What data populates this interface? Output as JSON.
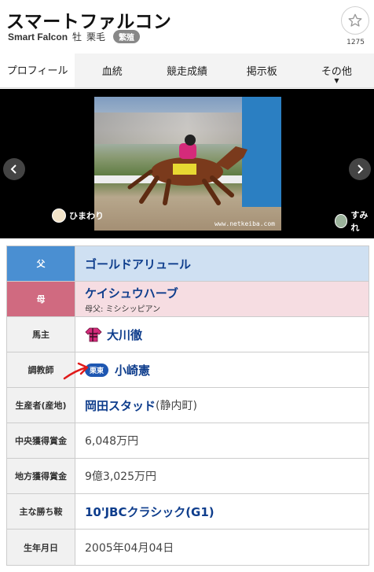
{
  "header": {
    "title": "スマートファルコン",
    "name_en": "Smart Falcon",
    "sex": "牡",
    "coat": "栗毛",
    "status_badge": "繁殖",
    "favorite_count": "1275"
  },
  "tabs": [
    {
      "label": "プロフィール",
      "active": true
    },
    {
      "label": "血統",
      "active": false
    },
    {
      "label": "競走成績",
      "active": false
    },
    {
      "label": "掲示板",
      "active": false
    },
    {
      "label": "その他",
      "active": false
    }
  ],
  "photo": {
    "watermark": "www.netkeiba.com",
    "credit_left": "ひまわり",
    "credit_right": "すみれ"
  },
  "profile": {
    "sire_label": "父",
    "sire": "ゴールドアリュール",
    "dam_label": "母",
    "dam": "ケイシュウハーブ",
    "dam_sire": "母父: ミシシッピアン",
    "owner_label": "馬主",
    "owner": "大川徹",
    "trainer_label": "調教師",
    "trainer_affil": "栗東",
    "trainer": "小崎憲",
    "breeder_label": "生産者(産地)",
    "breeder": "岡田スタッド",
    "breeder_region": "(静内町)",
    "central_earnings_label": "中央獲得賞金",
    "central_earnings": "6,048万円",
    "local_earnings_label": "地方獲得賞金",
    "local_earnings": "9億3,025万円",
    "major_win_label": "主な勝ち鞍",
    "major_win": "10'JBCクラシック(G1)",
    "birthdate_label": "生年月日",
    "birthdate": "2005年04月04日"
  },
  "colors": {
    "sire_header": "#4a8fd2",
    "dam_header": "#d06a80",
    "link": "#0e3d8c",
    "ritto_badge": "#1e57b2"
  }
}
